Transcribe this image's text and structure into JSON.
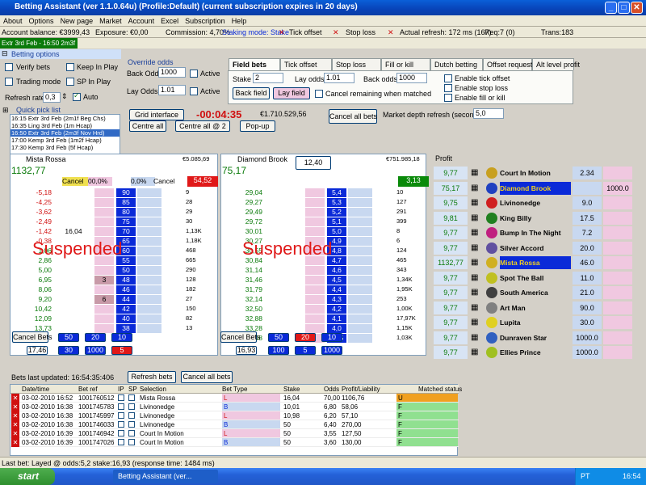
{
  "window": {
    "title": "Betting Assistant (ver 1.1.0.64u)      (Profile:Default)      (current subscription expires in 20 days)"
  },
  "menu": [
    "About",
    "Options",
    "New page",
    "Market",
    "Account",
    "Excel",
    "Subscription",
    "Help"
  ],
  "status": {
    "balance": "Account balance: €3999,43",
    "exposure": "Exposure: €0,00",
    "commission": "Commission: 4,70%",
    "staking": "Staking mode: Stake",
    "tick": "Tick offset",
    "stop": "Stop loss",
    "refresh": "Actual refresh: 172 ms (167)",
    "req": "Req:7 (0)",
    "trans": "Trans:183"
  },
  "race_tab": "Extr 3rd Feb - 16:50 2m3f N...",
  "betting_options": {
    "title": "Betting options",
    "verify": "Verify bets",
    "keep_in_play": "Keep In Play",
    "trading": "Trading mode",
    "sp_in_play": "SP In Play",
    "refresh_label": "Refresh rate",
    "refresh_value": "0,3",
    "auto": "Auto",
    "override_title": "Override odds",
    "back_odds": "Back Odds",
    "back_odds_val": "1000",
    "lay_odds": "Lay Odds",
    "lay_odds_val": "1.01",
    "active": "Active"
  },
  "tabs2": [
    "Field bets",
    "Tick offset",
    "Stop loss",
    "Fill or kill",
    "Dutch betting",
    "Offset requests",
    "Alt level profit"
  ],
  "field": {
    "stake": "Stake",
    "stake_val": "2",
    "lay_odds": "Lay odds",
    "lay_val": "1.01",
    "back_odds": "Back odds",
    "back_val": "1000",
    "back_field": "Back field",
    "lay_field": "Lay field",
    "cancel_matched": "Cancel remaining when matched",
    "enable_tick": "Enable tick offset",
    "enable_stop": "Enable stop loss",
    "enable_fok": "Enable fill or kill"
  },
  "quick_pick": {
    "title": "Quick pick list",
    "items": [
      "16:15 Extr 3rd Feb (2m1f Beg Chs)",
      "16:35 Ling 3rd Feb (1m Hcap)",
      "16:50 Extr 3rd Feb (2m3f Nov Hrd)",
      "17:00 Kemp 3rd Feb (1m2f Hcap)",
      "17:30 Kemp 3rd Feb (5f Hcap)"
    ]
  },
  "controls": {
    "grid": "Grid interface",
    "timer": "-00:04:35",
    "matched": "€1.710.529,56",
    "cancel_all": "Cancel all bets",
    "centre_all": "Centre all",
    "centre_all2": "Centre all @ 2",
    "popup": "Pop-up",
    "depth_label": "Market depth refresh (seconds)",
    "depth_val": "5,0"
  },
  "ladder_left": {
    "name": "Mista Rossa",
    "matched": "€5.085,69",
    "pl": "1132,77",
    "cancel": "Cancel",
    "pct1": "00,0%",
    "pct2": "0,0%",
    "cancel2": "Cancel",
    "ltp": "54,52",
    "profits": [
      "-5,18",
      "-4,25",
      "-3,62",
      "-2,49",
      "-1,42",
      "-0,38",
      "1,06",
      "2,86",
      "5,00",
      "6,95",
      "8,06",
      "9,20",
      "10,42",
      "12,09",
      "13,73"
    ],
    "backq": [
      "",
      "",
      "",
      "",
      "16,04",
      "",
      "",
      "",
      "",
      "",
      "",
      "",
      "",
      "",
      ""
    ],
    "odds": [
      "90",
      "85",
      "80",
      "75",
      "70",
      "65",
      "60",
      "55",
      "50",
      "48",
      "46",
      "44",
      "42",
      "40",
      "38"
    ],
    "layq": [
      "",
      "",
      "",
      "",
      "",
      "",
      "",
      "",
      "",
      "3",
      "",
      "6",
      "",
      "",
      ""
    ],
    "vol": [
      "9",
      "28",
      "29",
      "30",
      "1,13K",
      "1,18K",
      "468",
      "665",
      "290",
      "128",
      "182",
      "27",
      "150",
      "82",
      "13"
    ],
    "suspended": "Suspended",
    "cancel_bets": "Cancel Bets",
    "qs": [
      "50",
      "20",
      "10"
    ],
    "qs2": [
      "30",
      "1000",
      "5"
    ],
    "stake_box": "17,46"
  },
  "ladder_right": {
    "name": "Diamond Brook",
    "matched": "€751.985,18",
    "pl": "75,17",
    "odds_box": "12,40",
    "ltp": "3,13",
    "profits": [
      "29,04",
      "29,27",
      "29,49",
      "29,72",
      "30,01",
      "30,27",
      "30,55",
      "30,84",
      "31,14",
      "31,46",
      "31,79",
      "32,14",
      "32,50",
      "32,88",
      "33,28",
      "33,48"
    ],
    "odds": [
      "5,4",
      "5,3",
      "5,2",
      "5,1",
      "5,0",
      "4,9",
      "4,8",
      "4,7",
      "4,6",
      "4,5",
      "4,4",
      "4,3",
      "4,2",
      "4,1",
      "4,0",
      "3,95"
    ],
    "vol": [
      "10",
      "127",
      "291",
      "399",
      "8",
      "6",
      "124",
      "465",
      "343",
      "1,34K",
      "1,95K",
      "253",
      "1,00K",
      "17,97K",
      "1,15K",
      "1,03K"
    ],
    "suspended": "Suspended",
    "cancel_bets": "Cancel Bets",
    "qs": [
      "50",
      "20",
      "10"
    ],
    "qs2": [
      "100",
      "5",
      "1000"
    ],
    "stake_box": "16,93"
  },
  "profit_header": "Profit",
  "runners": [
    {
      "profit": "9,77",
      "name": "Court In Motion",
      "odds": "2.34",
      "extra": ""
    },
    {
      "profit": "75,17",
      "name": "Diamond Brook",
      "odds": "",
      "extra": "1000.0"
    },
    {
      "profit": "9,75",
      "name": "Livinonedge",
      "odds": "9.0",
      "extra": ""
    },
    {
      "profit": "9,81",
      "name": "King Billy",
      "odds": "17.5",
      "extra": ""
    },
    {
      "profit": "9,77",
      "name": "Bump In The Night",
      "odds": "7.2",
      "extra": ""
    },
    {
      "profit": "9,77",
      "name": "Silver Accord",
      "odds": "20.0",
      "extra": ""
    },
    {
      "profit": "1132,77",
      "name": "Mista Rossa",
      "odds": "46.0",
      "extra": ""
    },
    {
      "profit": "9,77",
      "name": "Spot The Ball",
      "odds": "11.0",
      "extra": ""
    },
    {
      "profit": "9,77",
      "name": "South America",
      "odds": "21.0",
      "extra": ""
    },
    {
      "profit": "9,77",
      "name": "Art Man",
      "odds": "90.0",
      "extra": ""
    },
    {
      "profit": "9,77",
      "name": "Lupita",
      "odds": "30.0",
      "extra": ""
    },
    {
      "profit": "9,77",
      "name": "Dunraven Star",
      "odds": "1000.0",
      "extra": ""
    },
    {
      "profit": "9,77",
      "name": "Ellies Prince",
      "odds": "1000.0",
      "extra": ""
    }
  ],
  "bets": {
    "updated": "Bets last updated: 16:54:35:406",
    "refresh": "Refresh bets",
    "cancel": "Cancel all bets",
    "headers": [
      "Date/time",
      "Bet ref",
      "IP",
      "SP",
      "Selection",
      "Bet Type",
      "Stake",
      "Odds",
      "Profit/Liability",
      "Matched status"
    ],
    "rows": [
      [
        "03-02-2010 16:52",
        "1001760512",
        "Mista Rossa",
        "L",
        "16,04",
        "70,00",
        "1106,76",
        "U"
      ],
      [
        "03-02-2010 16:38",
        "1001745783",
        "Livinonedge",
        "B",
        "10,01",
        "6,80",
        "58,06",
        "F"
      ],
      [
        "03-02-2010 16:38",
        "1001745997",
        "Livinonedge",
        "L",
        "10,98",
        "6,20",
        "57,10",
        "F"
      ],
      [
        "03-02-2010 16:38",
        "1001746033",
        "Livinonedge",
        "B",
        "50",
        "6,40",
        "270,00",
        "F"
      ],
      [
        "03-02-2010 16:39",
        "1001746942",
        "Court In Motion",
        "L",
        "50",
        "3,55",
        "127,50",
        "F"
      ],
      [
        "03-02-2010 16:39",
        "1001747026",
        "Court In Motion",
        "B",
        "50",
        "3,60",
        "130,00",
        "F"
      ]
    ]
  },
  "statusbar": "Last bet: Layed  @ odds:5,2 stake:16,93 (response time: 1484 ms)",
  "taskbar": {
    "start": "start",
    "app": "Betting Assistant (ver...",
    "lang": "PT",
    "time": "16:54"
  },
  "colors": {
    "back_blue": "#0a2ad8",
    "lay_pink": "#f0c8e0",
    "green_tab": "#0a7a0a"
  }
}
